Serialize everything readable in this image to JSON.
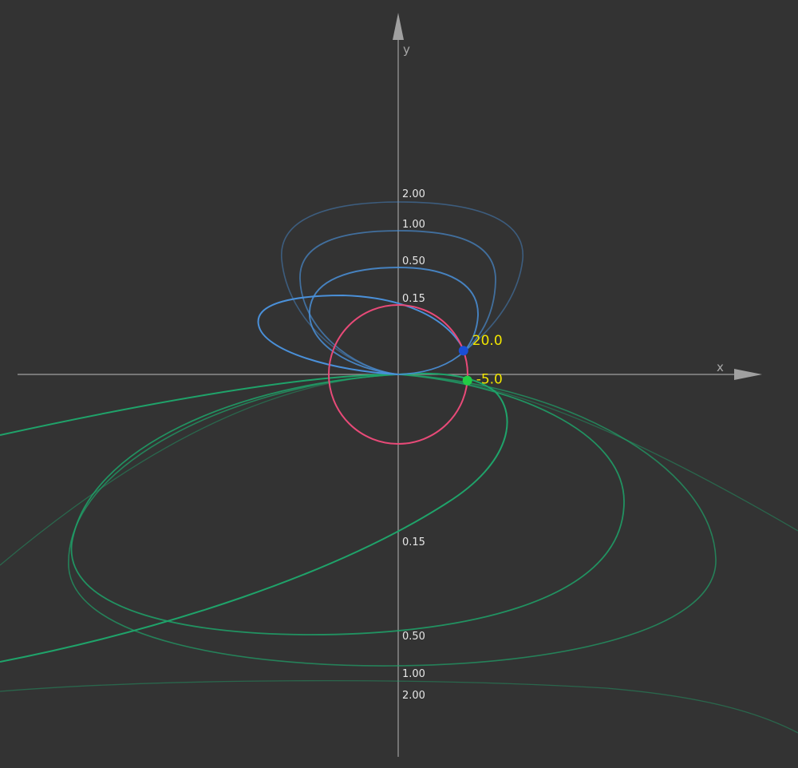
{
  "axes": {
    "x_label": "x",
    "y_label": "y",
    "axis_color": "#a0a0a0"
  },
  "circle": {
    "color": "#e84a78",
    "radius": 1
  },
  "upper_curves": {
    "color": "#4a90d9",
    "labels": [
      "2.00",
      "1.00",
      "0.50",
      "0.15"
    ]
  },
  "lower_curves": {
    "color": "#1fa36a",
    "labels": [
      "0.15",
      "0.50",
      "1.00",
      "2.00"
    ]
  },
  "points": [
    {
      "id": "blue",
      "label": "20.0",
      "color": "#1a4fd6",
      "angle_deg": 20.0
    },
    {
      "id": "green",
      "label": "-5.0",
      "color": "#22cc44",
      "angle_deg": -5.0
    }
  ]
}
